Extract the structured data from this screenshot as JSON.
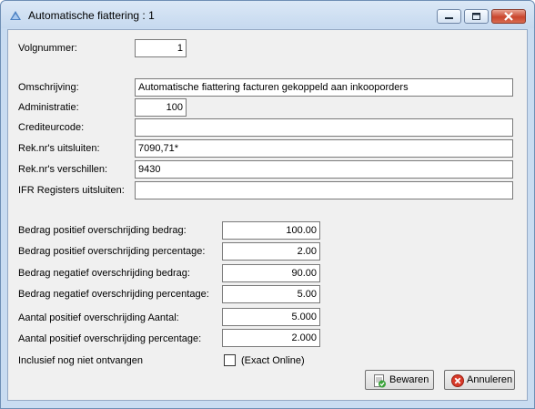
{
  "window": {
    "title": "Automatische fiattering : 1"
  },
  "form": {
    "volgnummer": {
      "label": "Volgnummer:",
      "value": "1"
    },
    "omschrijving": {
      "label": "Omschrijving:",
      "value": "Automatische fiattering facturen gekoppeld aan inkooporders"
    },
    "administratie": {
      "label": "Administratie:",
      "value": "100"
    },
    "crediteurcode": {
      "label": "Crediteurcode:",
      "value": ""
    },
    "reknr_uitsluiten": {
      "label": "Rek.nr's uitsluiten:",
      "value": "7090,71*"
    },
    "reknr_verschillen": {
      "label": "Rek.nr's verschillen:",
      "value": "9430"
    },
    "ifr_registers": {
      "label": "IFR Registers uitsluiten:",
      "value": ""
    },
    "bedrag_pos_bedrag": {
      "label": "Bedrag positief overschrijding bedrag:",
      "value": "100.00"
    },
    "bedrag_pos_perc": {
      "label": "Bedrag positief overschrijding percentage:",
      "value": "2.00"
    },
    "bedrag_neg_bedrag": {
      "label": "Bedrag negatief overschrijding bedrag:",
      "value": "90.00"
    },
    "bedrag_neg_perc": {
      "label": "Bedrag negatief overschrijding percentage:",
      "value": "5.00"
    },
    "aantal_pos_aantal": {
      "label": "Aantal positief overschrijding Aantal:",
      "value": "5.000"
    },
    "aantal_pos_perc": {
      "label": "Aantal positief overschrijding percentage:",
      "value": "2.000"
    },
    "inclusief": {
      "label": "Inclusief nog niet ontvangen",
      "checkbox_label": "(Exact Online)",
      "checked": false
    }
  },
  "buttons": {
    "save": "Bewaren",
    "cancel": "Annuleren"
  },
  "icons": {
    "app": "app-icon",
    "save": "save-icon",
    "cancel": "cancel-icon"
  }
}
